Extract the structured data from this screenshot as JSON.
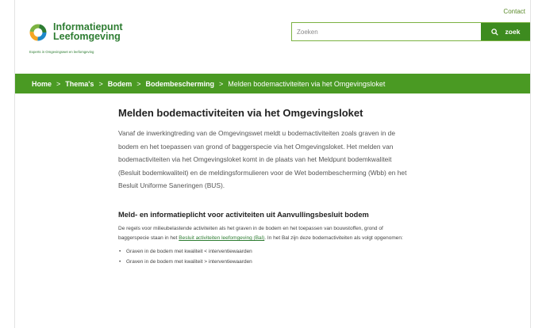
{
  "header": {
    "contact_label": "Contact",
    "logo_line1": "Informatiepunt",
    "logo_line2": "Leefomgeving",
    "logo_tagline": "Experts in Omgevingswet en leefomgeving",
    "search_placeholder": "Zoeken",
    "search_button_label": "zoek",
    "search_icon": "search-icon"
  },
  "breadcrumb": {
    "items": [
      "Home",
      "Thema's",
      "Bodem",
      "Bodembescherming"
    ],
    "current": "Melden bodemactiviteiten via het Omgevingsloket",
    "separator": ">"
  },
  "main": {
    "title": "Melden bodemactiviteiten via het Omgevingsloket",
    "intro": "Vanaf de inwerkingtreding van de Omgevingswet meldt u bodemactiviteiten zoals graven in de bodem en het toepassen van grond of baggerspecie via het Omgevingsloket. Het melden van bodemactiviteiten via het Omgevingsloket komt in de plaats van het Meldpunt bodemkwaliteit (Besluit bodemkwaliteit) en de meldingsformulieren voor de Wet bodembescherming (Wbb) en het Besluit Uniforme Saneringen (BUS).",
    "section_heading": "Meld- en informatieplicht voor activiteiten uit Aanvullingsbesluit bodem",
    "section_text_before": "De regels voor milieubelastende activiteiten als het graven in de bodem en het toepassen van bouwstoffen, grond of baggerspecie staan in het ",
    "section_link": "Besluit activiteiten leefomgeving (Bal)",
    "section_text_after": ". In het Bal zijn deze bodemactiviteiten als volgt opgenomen:",
    "bullets": [
      "Graven in de bodem met kwaliteit < interventiewaarden",
      "Graven in de bodem met kwaliteit > interventiewaarden"
    ]
  },
  "colors": {
    "brand_green": "#4a9a23",
    "button_green": "#3d8b1f",
    "link_green": "#2e7d32"
  }
}
